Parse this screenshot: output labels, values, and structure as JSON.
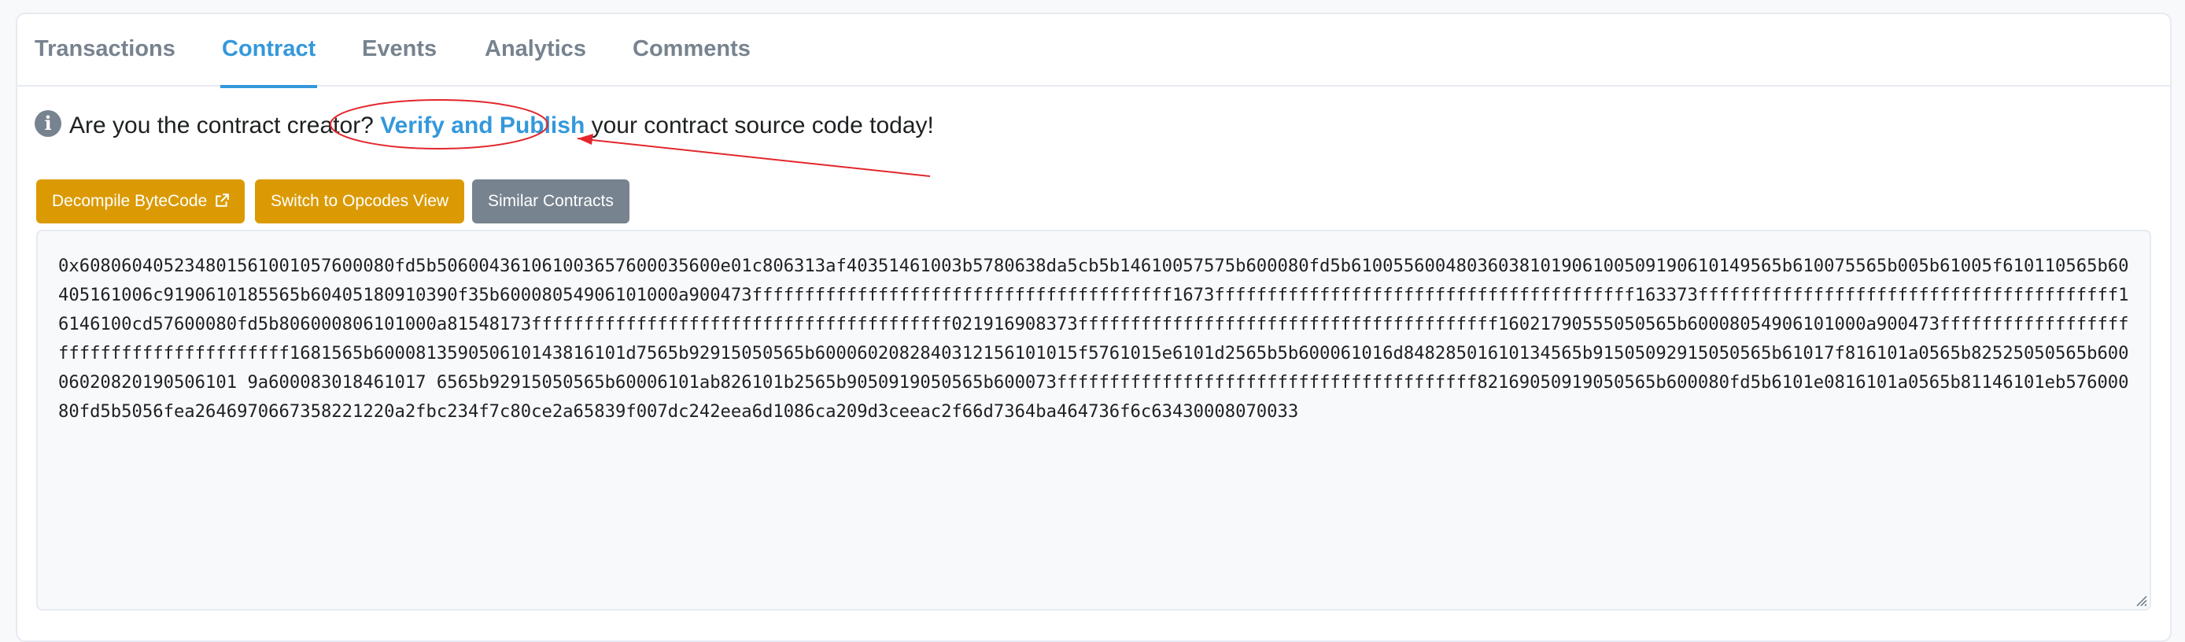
{
  "tabs": [
    {
      "label": "Transactions"
    },
    {
      "label": "Contract",
      "active": true
    },
    {
      "label": "Events"
    },
    {
      "label": "Analytics"
    },
    {
      "label": "Comments"
    }
  ],
  "notice": {
    "icon": "info-icon",
    "prefix": "Are you the contract creator? ",
    "link": "Verify and Publish",
    "suffix": " your contract source code today!",
    "annotation_color": "#e3262d"
  },
  "buttons": {
    "decompile": "Decompile ByteCode",
    "opcodes": "Switch to Opcodes View",
    "similar": "Similar Contracts"
  },
  "bytecode": "0x608060405234801561001057600080fd5b506004361061003657600035600e01c806313af40351461003b5780638da5cb5b14610057575b600080fd5b61005560048036038101906100509190610149565b610075565b005b61005f610110565b60405161006c9190610185565b60405180910390f35b60008054906101000a900473ffffffffffffffffffffffffffffffffffffffff1673ffffffffffffffffffffffffffffffffffffffff163373ffffffffffffffffffffffffffffffffffffffff16146100cd57600080fd5b806000806101000a81548173ffffffffffffffffffffffffffffffffffffffff021916908373ffffffffffffffffffffffffffffffffffffffff16021790555050565b60008054906101000a900473ffffffffffffffffffffffffffffffffffffffff1681565b600081359050610143816101d7565b92915050565b6000602082840312156101015f5761015e6101d2565b5b600061016d84828501610134565b91505092915050565b61017f816101a0565b82525050565b60006020820190506101 9a600083018461017 6565b92915050565b60006101ab826101b2565b9050919050565b600073ffffffffffffffffffffffffffffffffffffffff82169050919050565b600080fd5b6101e0816101a0565b81146101eb57600080fd5b5056fea2646970667358221220a2fbc234f7c80ce2a65839f007dc242eea6d1086ca209d3ceeac2f66d7364ba464736f6c63430008070033"
}
